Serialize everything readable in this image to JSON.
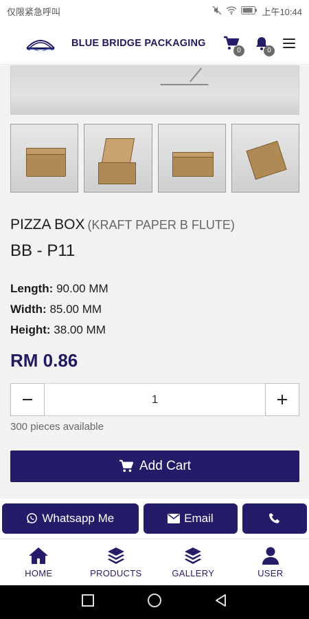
{
  "status_bar": {
    "left_text": "仅限紧急呼叫",
    "time": "上午10:44"
  },
  "header": {
    "brand": "BLUE BRIDGE PACKAGING",
    "cart_count": "0",
    "notification_count": "0"
  },
  "product": {
    "name": "PIZZA BOX",
    "variant": "(KRAFT PAPER B FLUTE)",
    "code": "BB - P11",
    "specs": [
      {
        "label": "Length:",
        "value": "90.00 MM"
      },
      {
        "label": "Width:",
        "value": "85.00 MM"
      },
      {
        "label": "Height:",
        "value": "38.00 MM"
      }
    ],
    "price": "RM 0.86",
    "quantity": "1",
    "stock_text": "300 pieces available",
    "add_cart_label": "Add Cart"
  },
  "contact": {
    "whatsapp_label": "Whatsapp Me",
    "email_label": "Email"
  },
  "bottom_nav": {
    "items": [
      {
        "label": "HOME",
        "icon": "home-icon"
      },
      {
        "label": "PRODUCTS",
        "icon": "layers-icon"
      },
      {
        "label": "GALLERY",
        "icon": "layers-icon"
      },
      {
        "label": "USER",
        "icon": "user-icon"
      }
    ]
  },
  "colors": {
    "brand_navy": "#231d69",
    "background": "#f2f2f2"
  }
}
